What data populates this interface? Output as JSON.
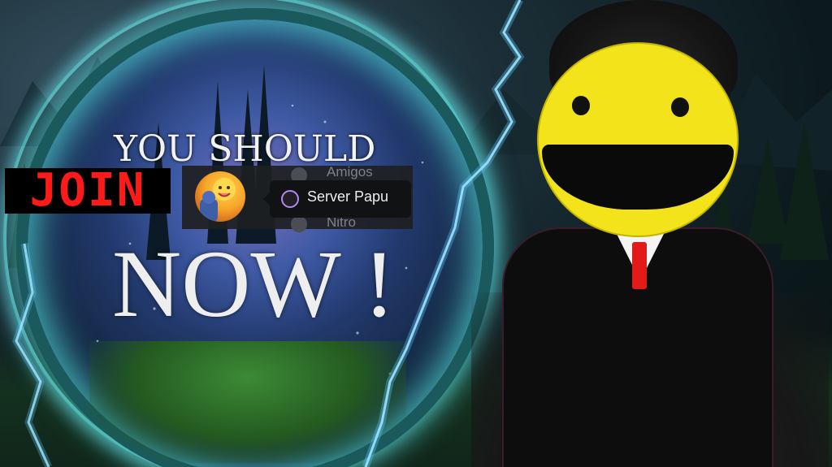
{
  "headline": {
    "line1": "YOU SHOULD",
    "join": "JOIN",
    "line3": "NOW !"
  },
  "discord": {
    "menu_items": [
      "Amigos",
      "Nitro"
    ],
    "tooltip_label": "Server Papu"
  },
  "colors": {
    "join_text": "#ff1a1a",
    "portal_glow": "#5ae6e6",
    "face": "#f2e31b",
    "tie": "#e21a1a",
    "tooltip_bg": "#111214",
    "server_icon_ring": "#b685f5"
  },
  "icons": [
    "server-avatar-icon",
    "server-tooltip-icon",
    "friends-icon",
    "nitro-icon"
  ]
}
